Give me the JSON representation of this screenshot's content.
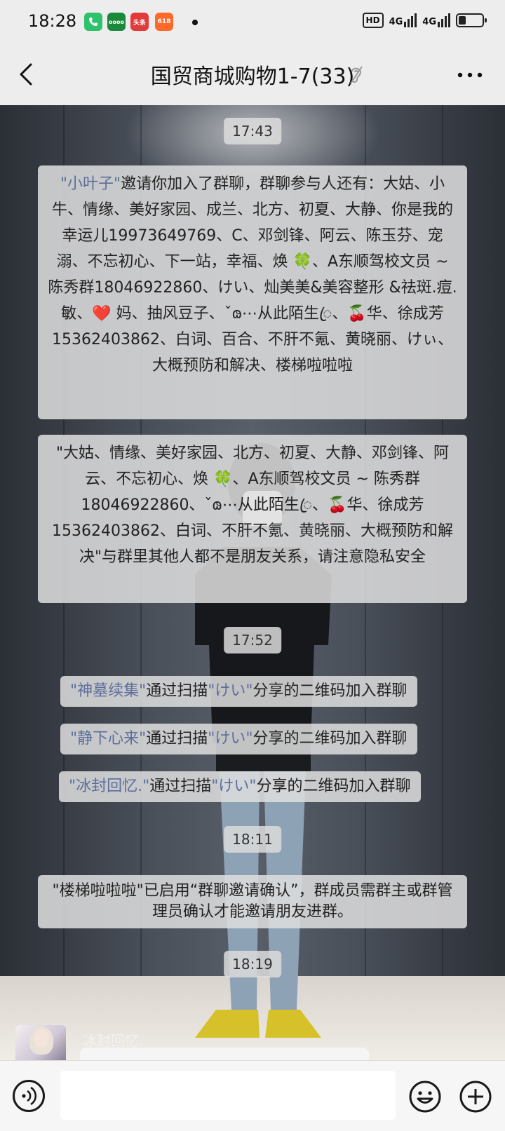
{
  "status_bar": {
    "time": "18:28",
    "apps": [
      {
        "name": "phone-app-icon",
        "label": "",
        "color": "#2dc26b"
      },
      {
        "name": "oppo-app-icon",
        "label": "oooo",
        "color": "#1a8a3a"
      },
      {
        "name": "toutiao-app-icon",
        "label": "头条",
        "color": "#e23b3b"
      },
      {
        "name": "taobao-618-app-icon",
        "label": "618",
        "color": "#ff6a2a"
      }
    ],
    "hd_badge": "HD",
    "network_1": "4G",
    "network_2": "4G",
    "battery_level": 0.3
  },
  "header": {
    "title": "国贸商城购物1-7(33)",
    "back_icon": "chevron-left-icon",
    "mute_icon": "ear-muted-icon",
    "more_icon": "more-dots-icon"
  },
  "messages": {
    "time_1": "17:43",
    "invite_1": {
      "inviter": "\"小叶子\"",
      "text": "邀请你加入了群聊，群聊参与人还有：大姑、小牛、情缘、美好家园、成兰、北方、初夏、大静、你是我的幸运儿19973649769、C、邓剑锋、阿云、陈玉芬、宠溺、不忘初心、下一站，幸福、焕 🍀、A东顺驾校文员 ~ 陈秀群18046922860、けい、灿美美&美容整形 &祛斑.痘.敏、❤️ 妈、抽风豆子、ˇ𐑀⋯从此陌生ꦿ、🍒华、徐成芳15362403862、白词、百合、不肝不氪、黄晓丽、けぃ、大概预防和解决、楼梯啦啦啦"
    },
    "notice_1": "\"大姑、情缘、美好家园、北方、初夏、大静、邓剑锋、阿云、不忘初心、焕 🍀、A东顺驾校文员 ~ 陈秀群18046922860、ˇ𐑀⋯从此陌生ꦿ、🍒华、徐成芳15362403862、白词、不肝不氪、黄晓丽、大概预防和解决\"与群里其他人都不是朋友关系，请注意隐私安全",
    "time_2": "17:52",
    "join_1": {
      "name": "\"神墓续集\"",
      "mid": "通过扫描",
      "sharer": "\"けい\"",
      "end": "分享的二维码加入群聊"
    },
    "join_2": {
      "name": "\"静下心来\"",
      "mid": "通过扫描",
      "sharer": "\"けい\"",
      "end": "分享的二维码加入群聊"
    },
    "join_3": {
      "name": "\"冰封回忆.\"",
      "mid": "通过扫描",
      "sharer": "\"けい\"",
      "end": "分享的二维码加入群聊"
    },
    "time_3": "18:11",
    "confirm_notice": "\"楼梯啦啦啦\"已启用“群聊邀请确认”，群成员需群主或群管理员确认才能邀请朋友进群。",
    "time_4": "18:19",
    "last_sender": "冰封回忆."
  },
  "input_bar": {
    "voice_icon": "voice-icon",
    "input_value": "",
    "emoji_icon": "emoji-icon",
    "plus_icon": "plus-icon"
  }
}
